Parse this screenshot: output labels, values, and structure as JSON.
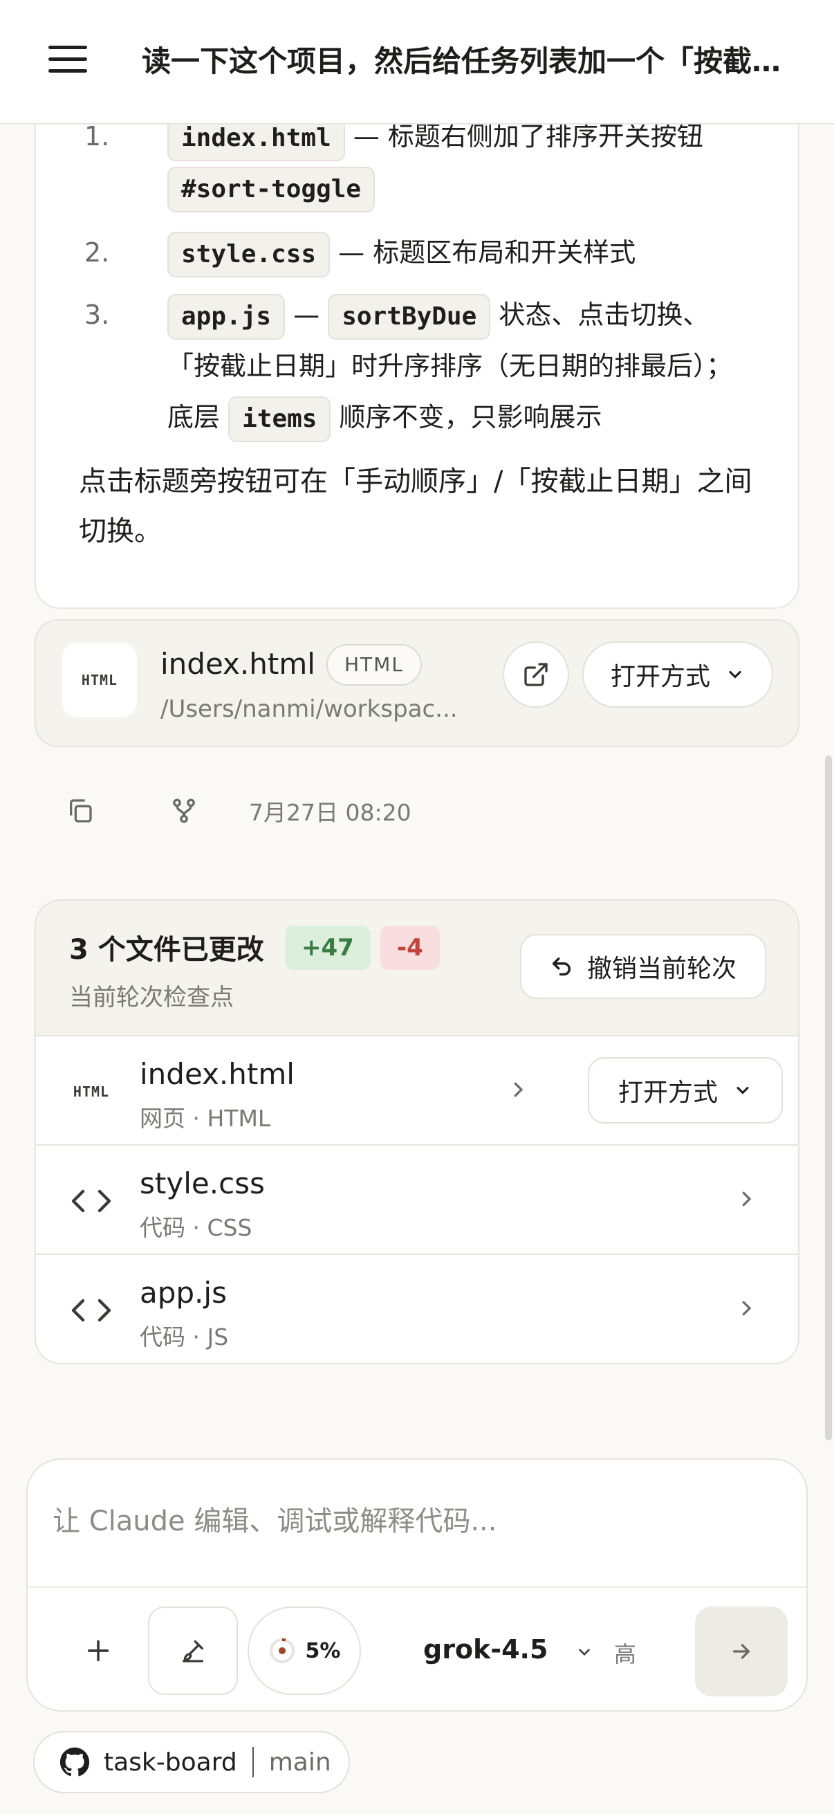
{
  "header": {
    "title": "读一下这个项目，然后给任务列表加一个「按截止日期排序」的切换"
  },
  "message": {
    "items": [
      {
        "num": "1.",
        "code1": "index.html",
        "text1": " — 标题右侧加了排序开关按钮",
        "code2": "#sort-toggle"
      },
      {
        "num": "2.",
        "code1": "style.css",
        "text1": " — 标题区布局和开关样式"
      },
      {
        "num": "3.",
        "code1": "app.js",
        "dash": " — ",
        "code2": "sortByDue",
        "text1": " 状态、点击切换、",
        "line2": "「按截止日期」时升序排序（无日期的排最后）；",
        "line3a": "底层 ",
        "code3": "items",
        "line3b": " 顺序不变，只影响展示"
      }
    ],
    "paragraph": "点击标题旁按钮可在「手动顺序」/「按截止日期」之间切换。"
  },
  "file_card": {
    "icon_label": "HTML",
    "name": "index.html",
    "badge": "HTML",
    "path": "/Users/nanmi/workspac...",
    "open_label": "打开方式"
  },
  "actions": {
    "timestamp": "7月27日 08:20"
  },
  "changes": {
    "title": "3 个文件已更改",
    "added": "+47",
    "removed": "-4",
    "subtitle": "当前轮次检查点",
    "undo_label": "撤销当前轮次",
    "files": [
      {
        "name": "index.html",
        "type": "网页 · HTML",
        "icon_label": "HTML",
        "open_label": "打开方式"
      },
      {
        "name": "style.css",
        "type": "代码 · CSS"
      },
      {
        "name": "app.js",
        "type": "代码 · JS"
      }
    ]
  },
  "composer": {
    "placeholder": "让 Claude 编辑、调试或解释代码...",
    "context_percent": "5%",
    "model": "grok-4.5",
    "effort": "高"
  },
  "repo": {
    "name": "task-board",
    "branch": "main"
  },
  "colors": {
    "added_green": "#3a7d44",
    "removed_red": "#c2453d",
    "context_ring": "#a0452e"
  }
}
